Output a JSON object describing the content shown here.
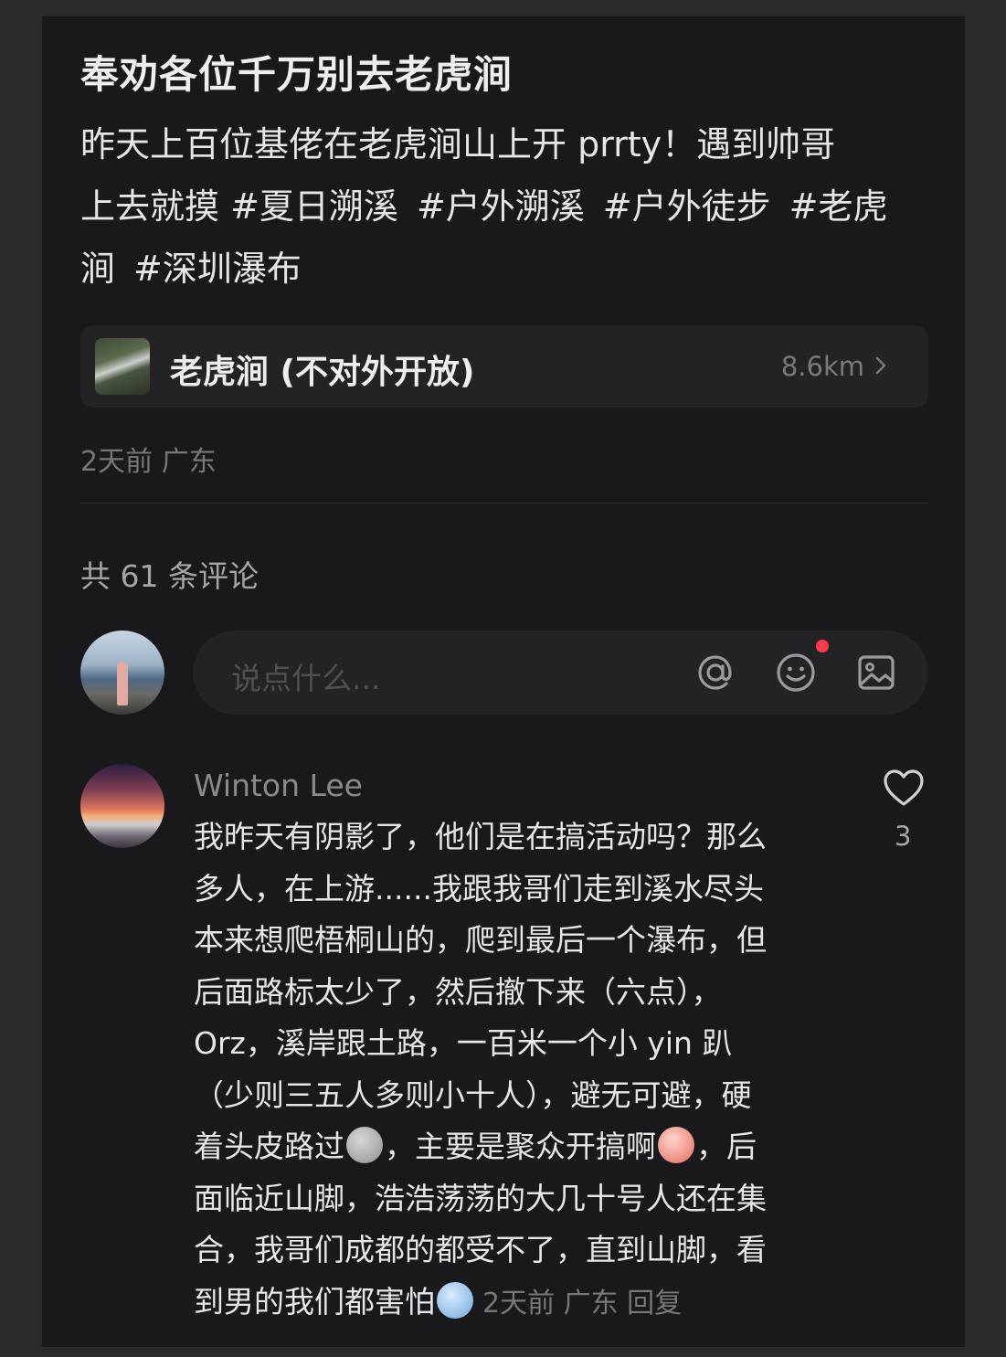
{
  "post": {
    "title": "奉劝各位千万别去老虎涧",
    "body_line1": "昨天上百位基佬在老虎涧山上开 prrty！遇到帅哥",
    "body_line2_prefix": "上去就摸 ",
    "tags": [
      "#夏日溯溪",
      "#户外溯溪",
      "#户外徒步",
      "#老虎涧",
      "#深圳瀑布"
    ],
    "location": {
      "name": "老虎涧 (不对外开放)",
      "distance": "8.6km"
    },
    "meta": "2天前 广东"
  },
  "comments_header": {
    "count_text": "共 61 条评论"
  },
  "input": {
    "placeholder": "说点什么..."
  },
  "icons": {
    "at": "at-icon",
    "emoji": "emoji-icon",
    "image": "image-icon",
    "like": "heart-icon",
    "chevron": "chevron-right-icon"
  },
  "comment": {
    "author": "Winton Lee",
    "lines": [
      "我昨天有阴影了，他们是在搞活动吗？那么",
      "多人，在上游......我跟我哥们走到溪水尽头",
      "本来想爬梧桐山的，爬到最后一个瀑布，但",
      "后面路标太少了，然后撤下来（六点），",
      "Orz，溪岸跟土路，一百米一个小 yin 趴",
      "（少则三五人多则小十人），避无可避，硬"
    ],
    "line7_a": "着头皮路过",
    "line7_b": "，主要是聚众开搞啊",
    "line7_c": "，后",
    "line8": "面临近山脚，浩浩荡荡的大几十号人还在集",
    "line9": "合，我哥们成都的都受不了，直到山脚，看",
    "line10": "到男的我们都害怕",
    "meta": "2天前 广东 回复",
    "likes": "3"
  }
}
